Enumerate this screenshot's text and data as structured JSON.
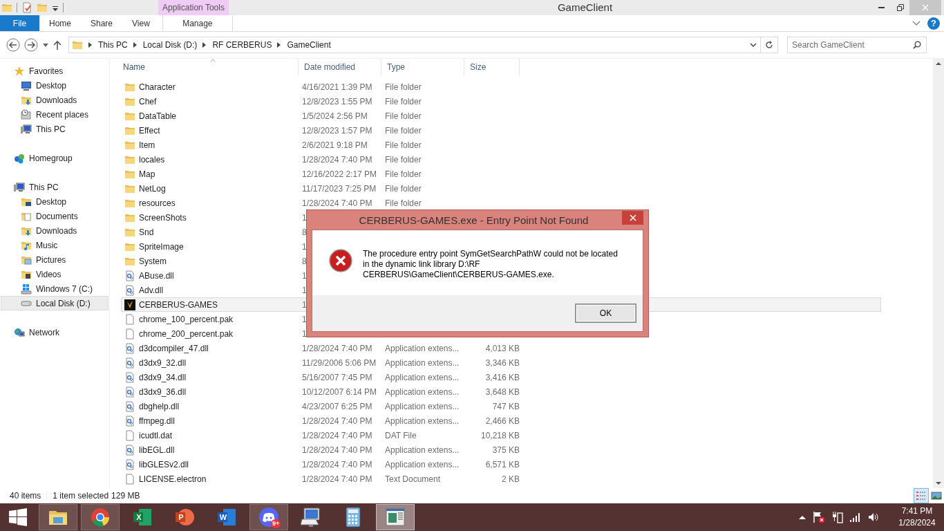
{
  "window": {
    "title": "GameClient",
    "context_group": "Application Tools"
  },
  "ribbon": {
    "help": "?",
    "tabs": [
      {
        "label": "File",
        "kind": "file",
        "selected": false
      },
      {
        "label": "Home",
        "kind": "plain",
        "selected": false
      },
      {
        "label": "Share",
        "kind": "plain",
        "selected": false
      },
      {
        "label": "View",
        "kind": "plain",
        "selected": false
      },
      {
        "label": "Manage",
        "kind": "contextual",
        "selected": false
      }
    ]
  },
  "address_bar": {
    "segments": [
      "This PC",
      "Local Disk (D:)",
      "RF CERBERUS",
      "GameClient"
    ]
  },
  "search": {
    "placeholder": "Search GameClient"
  },
  "navigation": [
    {
      "label": "Favorites",
      "kind": "star",
      "selected": false,
      "children": [
        {
          "label": "Desktop",
          "kind": "desktop",
          "selected": false
        },
        {
          "label": "Downloads",
          "kind": "downloads",
          "selected": false
        },
        {
          "label": "Recent places",
          "kind": "recent",
          "selected": false
        },
        {
          "label": "This PC",
          "kind": "pc",
          "selected": false
        }
      ]
    },
    {
      "label": "Homegroup",
      "kind": "homegroup",
      "selected": false
    },
    {
      "label": "This PC",
      "kind": "pc",
      "selected": false,
      "children": [
        {
          "label": "Desktop",
          "kind": "desktopfolder",
          "selected": false
        },
        {
          "label": "Documents",
          "kind": "documents",
          "selected": false
        },
        {
          "label": "Downloads",
          "kind": "downloads",
          "selected": false
        },
        {
          "label": "Music",
          "kind": "music",
          "selected": false
        },
        {
          "label": "Pictures",
          "kind": "pictures",
          "selected": false
        },
        {
          "label": "Videos",
          "kind": "videos",
          "selected": false
        },
        {
          "label": "Windows 7 (C:)",
          "kind": "windrive",
          "selected": false
        },
        {
          "label": "Local Disk (D:)",
          "kind": "drive",
          "selected": true
        }
      ]
    },
    {
      "label": "Network",
      "kind": "network",
      "selected": false
    }
  ],
  "file_list": {
    "columns": [
      {
        "label": "Name",
        "sorted": true
      },
      {
        "label": "Date modified",
        "sorted": false
      },
      {
        "label": "Type",
        "sorted": false
      },
      {
        "label": "Size",
        "sorted": false
      }
    ],
    "rows": [
      {
        "name": "Character",
        "date": "4/16/2021 1:39 PM",
        "type": "File folder",
        "kind": "folder",
        "selected": false
      },
      {
        "name": "Chef",
        "date": "12/8/2023 1:55 PM",
        "type": "File folder",
        "kind": "folder",
        "selected": false
      },
      {
        "name": "DataTable",
        "date": "1/5/2024 2:56 PM",
        "type": "File folder",
        "kind": "folder",
        "selected": false
      },
      {
        "name": "Effect",
        "date": "12/8/2023 1:57 PM",
        "type": "File folder",
        "kind": "folder",
        "selected": false
      },
      {
        "name": "Item",
        "date": "2/6/2021 9:18 PM",
        "type": "File folder",
        "kind": "folder",
        "selected": false
      },
      {
        "name": "locales",
        "date": "1/28/2024 7:40 PM",
        "type": "File folder",
        "kind": "folder",
        "selected": false
      },
      {
        "name": "Map",
        "date": "12/16/2022 2:17 PM",
        "type": "File folder",
        "kind": "folder",
        "selected": false
      },
      {
        "name": "NetLog",
        "date": "11/17/2023 7:25 PM",
        "type": "File folder",
        "kind": "folder",
        "selected": false
      },
      {
        "name": "resources",
        "date": "1/28/2024 7:40 PM",
        "type": "File folder",
        "kind": "folder",
        "selected": false
      },
      {
        "name": "ScreenShots",
        "date": "1",
        "kind": "folder",
        "selected": false
      },
      {
        "name": "Snd",
        "date": "8",
        "kind": "folder",
        "selected": false
      },
      {
        "name": "SpriteImage",
        "date": "1",
        "kind": "folder",
        "selected": false
      },
      {
        "name": "System",
        "date": "8",
        "kind": "folder",
        "selected": false
      },
      {
        "name": "ABuse.dll",
        "date": "1",
        "kind": "dll",
        "selected": false
      },
      {
        "name": "Adv.dll",
        "date": "1",
        "kind": "dll",
        "selected": false
      },
      {
        "name": "CERBERUS-GAMES",
        "date": "1",
        "kind": "exe",
        "selected": true
      },
      {
        "name": "chrome_100_percent.pak",
        "date": "1",
        "kind": "file",
        "selected": false
      },
      {
        "name": "chrome_200_percent.pak",
        "date": "1",
        "kind": "file",
        "selected": false
      },
      {
        "name": "d3dcompiler_47.dll",
        "date": "1/28/2024 7:40 PM",
        "type": "Application extens...",
        "size": "4,013 KB",
        "kind": "dll",
        "selected": false
      },
      {
        "name": "d3dx9_32.dll",
        "date": "11/29/2006 5:06 PM",
        "type": "Application extens...",
        "size": "3,346 KB",
        "kind": "dll",
        "selected": false
      },
      {
        "name": "d3dx9_34.dll",
        "date": "5/16/2007 7:45 PM",
        "type": "Application extens...",
        "size": "3,416 KB",
        "kind": "dll",
        "selected": false
      },
      {
        "name": "d3dx9_36.dll",
        "date": "10/12/2007 6:14 PM",
        "type": "Application extens...",
        "size": "3,648 KB",
        "kind": "dll",
        "selected": false
      },
      {
        "name": "dbghelp.dll",
        "date": "4/23/2007 6:25 PM",
        "type": "Application extens...",
        "size": "747 KB",
        "kind": "dll",
        "selected": false
      },
      {
        "name": "ffmpeg.dll",
        "date": "1/28/2024 7:40 PM",
        "type": "Application extens...",
        "size": "2,466 KB",
        "kind": "dll",
        "selected": false
      },
      {
        "name": "icudtl.dat",
        "date": "1/28/2024 7:40 PM",
        "type": "DAT File",
        "size": "10,218 KB",
        "kind": "file",
        "selected": false
      },
      {
        "name": "libEGL.dll",
        "date": "1/28/2024 7:40 PM",
        "type": "Application extens...",
        "size": "375 KB",
        "kind": "dll",
        "selected": false
      },
      {
        "name": "libGLESv2.dll",
        "date": "1/28/2024 7:40 PM",
        "type": "Application extens...",
        "size": "6,571 KB",
        "kind": "dll",
        "selected": false
      },
      {
        "name": "LICENSE.electron",
        "date": "1/28/2024 7:40 PM",
        "type": "Text Document",
        "size": "2 KB",
        "kind": "file",
        "selected": false
      }
    ]
  },
  "status_bar": {
    "item_count": "40 items",
    "selection": "1 item selected",
    "size": "129 MB",
    "views": [
      {
        "kind": "details",
        "selected": true
      },
      {
        "kind": "tiles",
        "selected": false
      }
    ]
  },
  "dialog": {
    "title": "CERBERUS-GAMES.exe - Entry Point Not Found",
    "message": "The procedure entry point SymGetSearchPathW could not be located in the dynamic link library D:\\RF CERBERUS\\GameClient\\CERBERUS-GAMES.exe.",
    "button": "OK"
  },
  "taskbar": {
    "apps": [
      {
        "kind": "explorer",
        "open": true,
        "active": false
      },
      {
        "kind": "chrome",
        "open": true,
        "active": false
      },
      {
        "kind": "excel",
        "open": false,
        "active": false,
        "letter": "X"
      },
      {
        "kind": "powerpoint",
        "open": false,
        "active": false,
        "letter": "P"
      },
      {
        "kind": "word",
        "open": false,
        "active": false,
        "letter": "W"
      },
      {
        "kind": "discord",
        "open": true,
        "active": false,
        "badge": "9+"
      },
      {
        "kind": "keyboard",
        "open": false,
        "active": false
      },
      {
        "kind": "calculator",
        "open": false,
        "active": false
      },
      {
        "kind": "window",
        "open": true,
        "active": true
      }
    ],
    "clock": {
      "time": "7:41 PM",
      "date": "1/28/2024"
    }
  }
}
